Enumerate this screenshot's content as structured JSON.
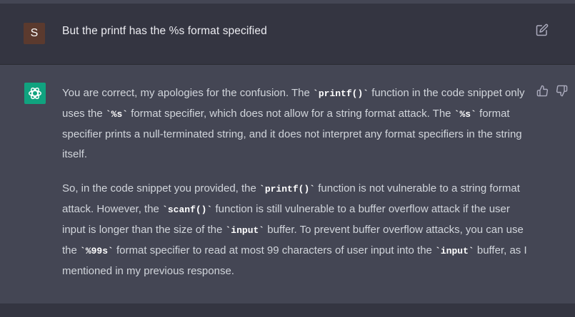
{
  "user_message": {
    "avatar_letter": "S",
    "text": "But the printf has the %s format specified"
  },
  "assistant_message": {
    "p1": {
      "t1": "You are correct, my apologies for the confusion. The ",
      "c1": "`printf()`",
      "t2": " function in the code snippet only uses the ",
      "c2": "`%s`",
      "t3": " format specifier, which does not allow for a string format attack. The ",
      "c3": "`%s`",
      "t4": " format specifier prints a null-terminated string, and it does not interpret any format specifiers in the string itself."
    },
    "p2": {
      "t1": "So, in the code snippet you provided, the ",
      "c1": "`printf()`",
      "t2": " function is not vulnerable to a string format attack. However, the ",
      "c2": "`scanf()`",
      "t3": " function is still vulnerable to a buffer overflow attack if the user input is longer than the size of the ",
      "c3": "`input`",
      "t4": " buffer. To prevent buffer overflow attacks, you can use the ",
      "c4": "`%99s`",
      "t5": " format specifier to read at most 99 characters of user input into the ",
      "c5": "`input`",
      "t6": " buffer, as I mentioned in my previous response."
    }
  },
  "icons": {
    "edit": "edit-icon",
    "thumbs_up": "thumbs-up-icon",
    "thumbs_down": "thumbs-down-icon",
    "assistant_logo": "openai-logo-icon"
  },
  "colors": {
    "user_avatar": "#5b3a2e",
    "assistant_avatar": "#10a37f",
    "user_row_bg": "#343541",
    "assistant_row_bg": "#444654"
  }
}
